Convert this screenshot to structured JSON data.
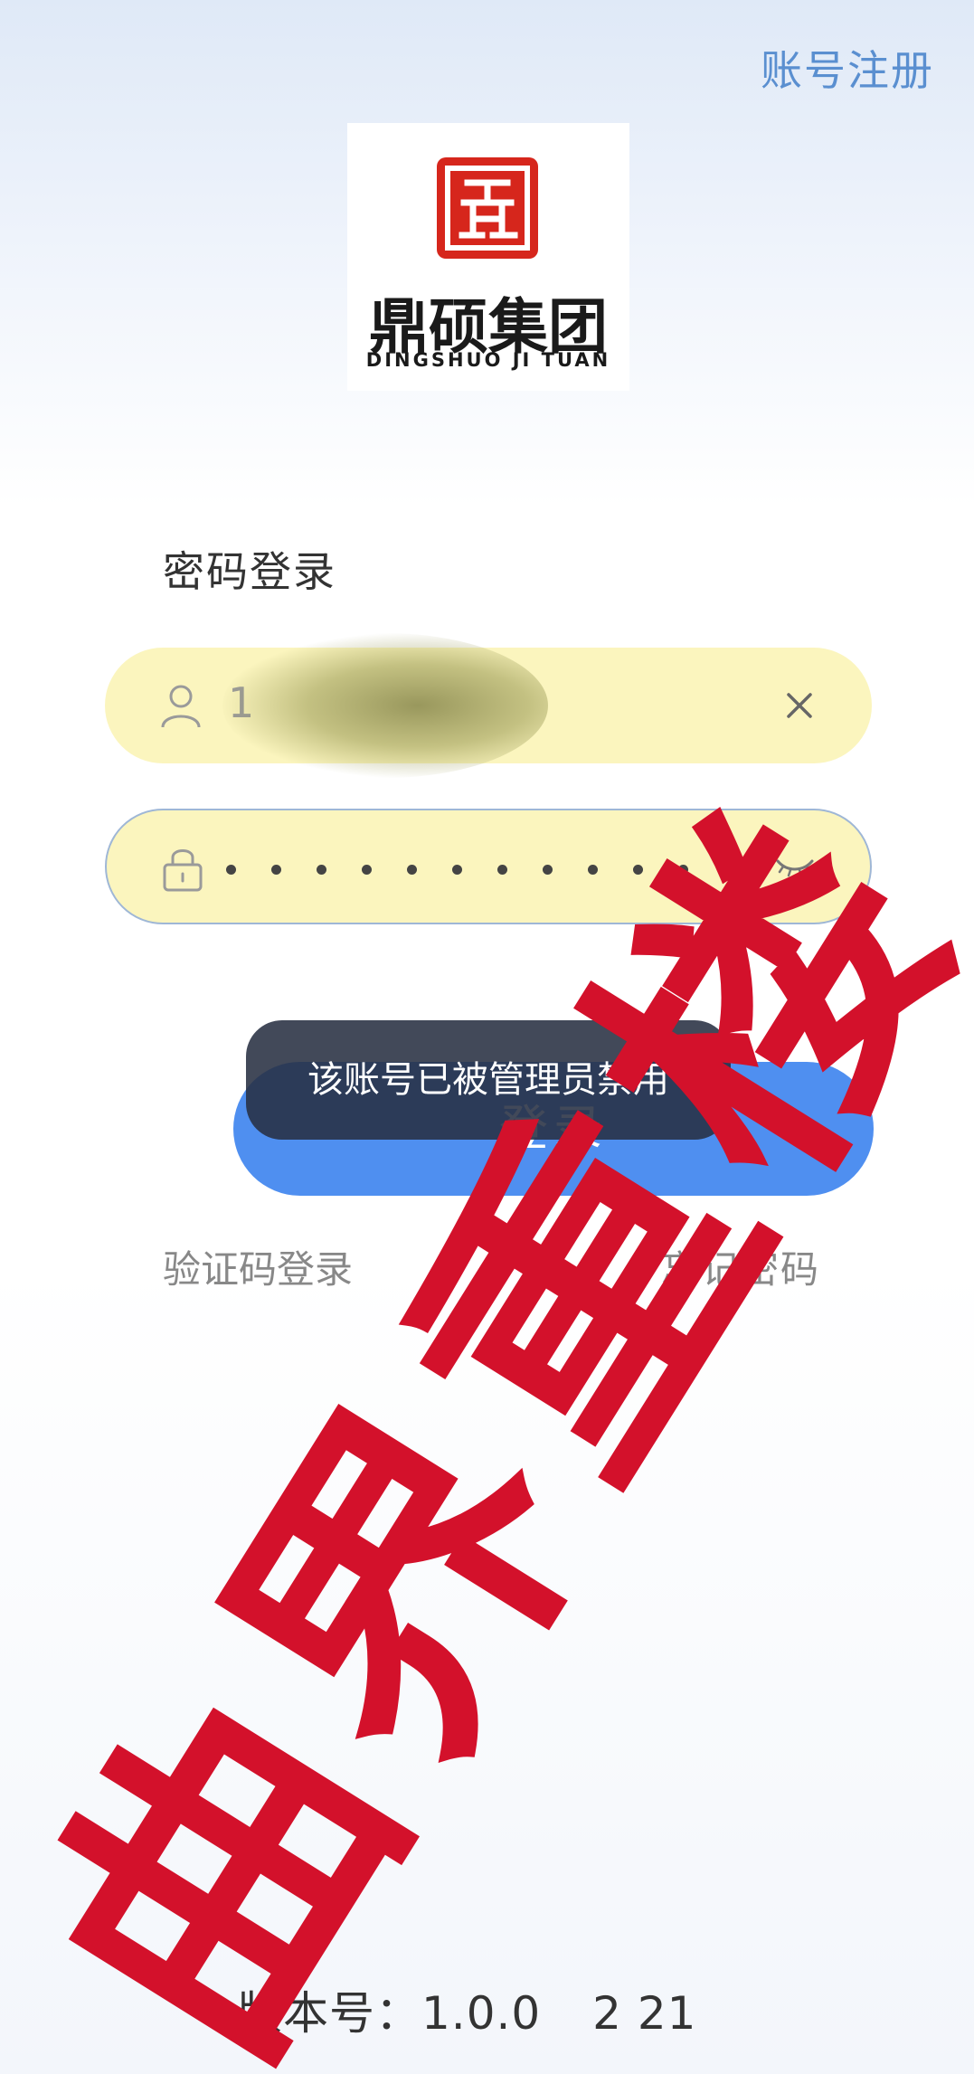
{
  "header": {
    "register_label": "账号注册"
  },
  "logo": {
    "name_cn": "鼎硕集团",
    "name_en": "DINGSHUO JI TUAN"
  },
  "login": {
    "title": "密码登录",
    "username_value": "1",
    "password_masked": "••••••••••••",
    "button_label": "登录",
    "sms_login_label": "验证码登录",
    "forgot_password_label": "忘记密码"
  },
  "toast": {
    "message": "该账号已被管理员禁用"
  },
  "footer": {
    "version_label": "版本号：1.0.0",
    "version_tail": "2 21"
  },
  "watermark": {
    "text": "曲界重楼",
    "color": "#d3112b"
  },
  "colors": {
    "accent": "#4f8ff0",
    "field_bg": "#fbf5be",
    "register_link": "#5a8fd0"
  },
  "icons": [
    "user-icon",
    "clear-icon",
    "lock-icon",
    "eye-closed-icon"
  ]
}
